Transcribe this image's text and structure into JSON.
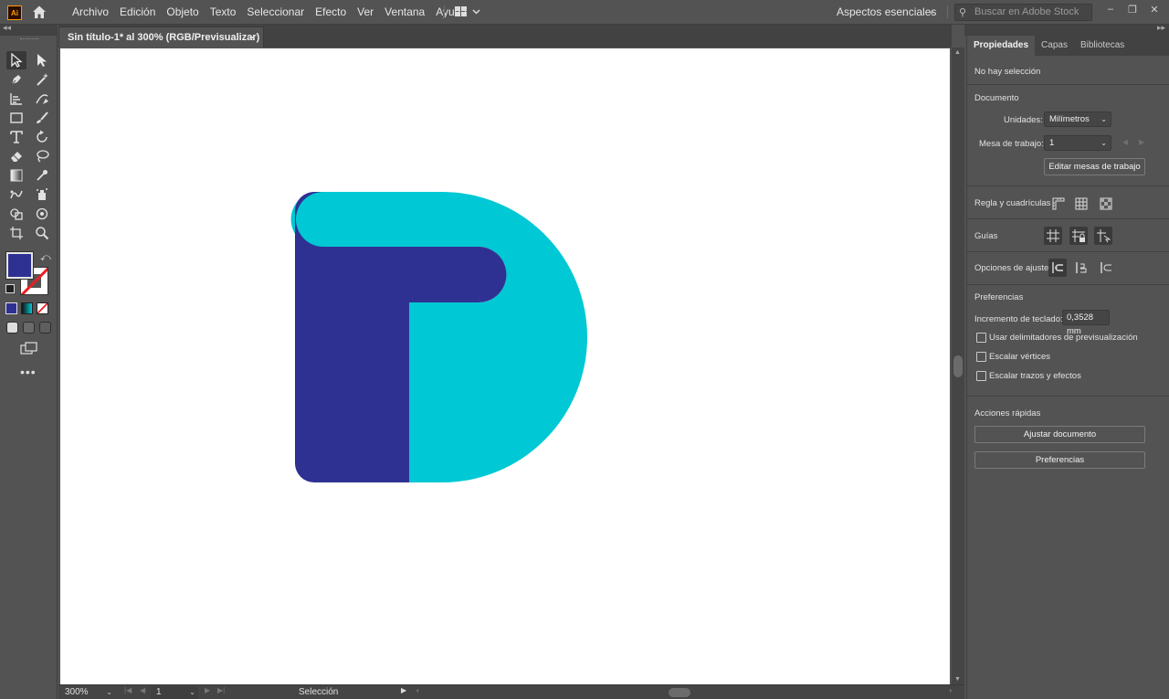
{
  "app": {
    "logo_text": "Ai",
    "menu": [
      "Archivo",
      "Edición",
      "Objeto",
      "Texto",
      "Seleccionar",
      "Efecto",
      "Ver",
      "Ventana",
      "Ayuda"
    ],
    "workspace": "Aspectos esenciales",
    "stock_search_placeholder": "Buscar en Adobe Stock",
    "window_controls": [
      "–",
      "❐",
      "✕"
    ]
  },
  "document": {
    "tab_title": "Sin título-1* al 300% (RGB/Previsualizar)",
    "tab_close": "×"
  },
  "artwork": {
    "colors": {
      "navy": "#2e3192",
      "cyan": "#00c8d4"
    }
  },
  "toolbar": {
    "fill_color": "#2e3192",
    "stroke": "none",
    "tools": [
      "selection-icon",
      "direct-selection-icon",
      "pen-icon",
      "magic-wand-icon",
      "type-on-path-icon",
      "curvature-icon",
      "rectangle-icon",
      "paintbrush-icon",
      "type-icon",
      "rotate-icon",
      "eraser-icon",
      "lasso-icon",
      "gradient-icon",
      "eyedropper-icon",
      "blend-icon",
      "symbol-sprayer-icon",
      "shape-builder-icon",
      "live-paint-icon",
      "artboard-icon",
      "zoom-icon"
    ],
    "more": "•••"
  },
  "status": {
    "zoom": "300%",
    "artboard": "1",
    "tool": "Selección"
  },
  "panel": {
    "tabs": [
      "Propiedades",
      "Capas",
      "Bibliotecas"
    ],
    "no_selection": "No hay selección",
    "document_heading": "Documento",
    "units_label": "Unidades:",
    "units_value": "Milímetros",
    "artboard_label": "Mesa de trabajo:",
    "artboard_value": "1",
    "edit_artboards": "Editar mesas de trabajo",
    "rulers_label": "Regla y cuadrículas",
    "guides_label": "Guías",
    "snap_label": "Opciones de ajuste",
    "preferences_heading": "Preferencias",
    "keyboard_inc_label": "Incremento de teclado:",
    "keyboard_inc_value": "0,3528 mm",
    "check_preview_bounds": "Usar delimitadores de previsualización",
    "check_scale_corners": "Escalar vértices",
    "check_scale_strokes": "Escalar trazos y efectos",
    "quick_actions_heading": "Acciones rápidas",
    "fit_document": "Ajustar documento",
    "preferences_button": "Preferencias"
  }
}
